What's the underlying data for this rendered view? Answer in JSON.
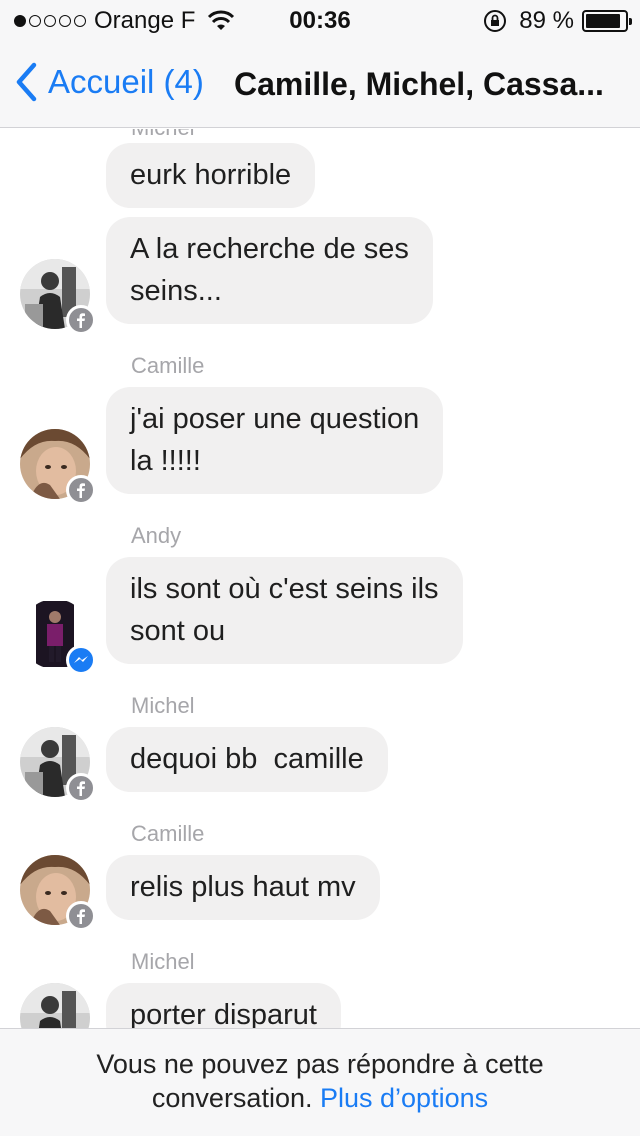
{
  "status_bar": {
    "carrier": "Orange F",
    "signal_bars": 1,
    "time": "00:36",
    "battery_percent": "89 %",
    "battery_level": 0.89
  },
  "nav": {
    "back_label": "Accueil (4)",
    "title": "Camille, Michel, Cassa..."
  },
  "messages": [
    {
      "sender": "",
      "text_lines": [
        "eurk horrible"
      ],
      "avatar": "",
      "badge": ""
    },
    {
      "sender": "",
      "text_lines": [
        "A la recherche de ses",
        "seins..."
      ],
      "avatar": "michel",
      "badge": "facebook"
    },
    {
      "sender": "Camille",
      "text_lines": [
        "j'ai poser une question",
        "la !!!!!"
      ],
      "avatar": "camille",
      "badge": "facebook"
    },
    {
      "sender": "Andy",
      "text_lines": [
        "ils sont où c'est seins ils",
        "sont ou"
      ],
      "avatar": "andy",
      "badge": "messenger"
    },
    {
      "sender": "Michel",
      "text_lines": [
        "dequoi bb  camille"
      ],
      "avatar": "michel",
      "badge": "facebook"
    },
    {
      "sender": "Camille",
      "text_lines": [
        "relis plus haut mv"
      ],
      "avatar": "camille",
      "badge": "facebook"
    },
    {
      "sender": "Michel",
      "text_lines": [
        "porter disparut"
      ],
      "avatar": "michel",
      "badge": "facebook"
    }
  ],
  "footer": {
    "notice": "Vous ne pouvez pas répondre à cette",
    "notice_line2": "conversation.",
    "link": "Plus d’options"
  },
  "colors": {
    "accent": "#1a7cf4",
    "bubble": "#f1f0f0",
    "bar_bg": "#f7f7f8"
  }
}
